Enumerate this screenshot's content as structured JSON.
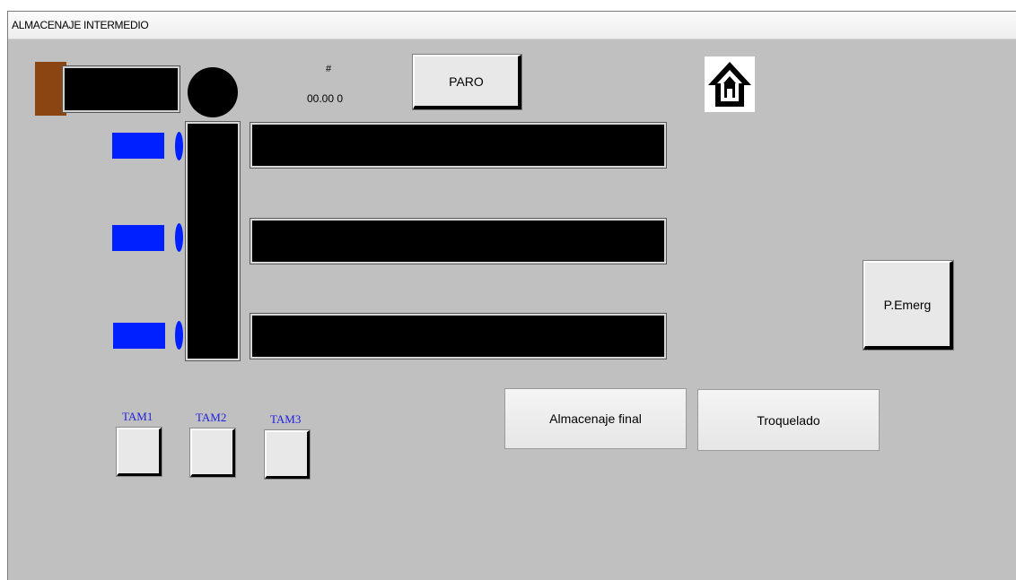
{
  "window": {
    "title": "ALMACENAJE INTERMEDIO"
  },
  "counter": {
    "symbol": "#",
    "value": "00.00 0"
  },
  "buttons": {
    "paro": "PARO",
    "emergency": "P.Emerg",
    "almacenaje_final": "Almacenaje final",
    "troquelado": "Troquelado"
  },
  "tam_selectors": [
    {
      "label": "TAM1"
    },
    {
      "label": "TAM2"
    },
    {
      "label": "TAM3"
    }
  ],
  "icons": {
    "home": "home-icon"
  },
  "colors": {
    "background": "#c0c0c0",
    "conveyor": "#000000",
    "piston": "#0020ff",
    "feeder": "#8b4513",
    "tam_label": "#2020e0"
  }
}
